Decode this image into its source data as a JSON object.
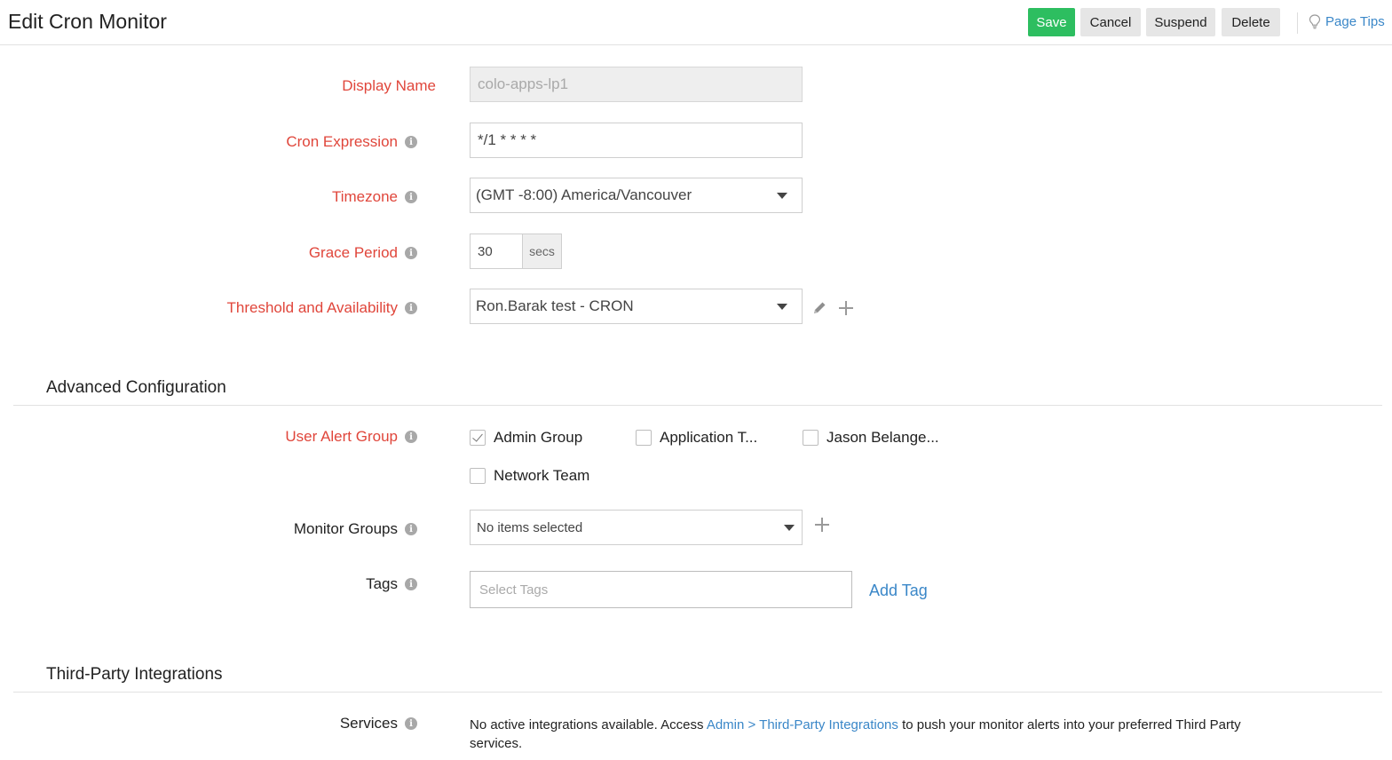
{
  "header": {
    "title": "Edit Cron Monitor",
    "buttons": {
      "save": "Save",
      "cancel": "Cancel",
      "suspend": "Suspend",
      "delete": "Delete"
    },
    "page_tips": "Page Tips"
  },
  "form": {
    "display_name": {
      "label": "Display Name",
      "value": "colo-apps-lp1"
    },
    "cron_expression": {
      "label": "Cron Expression",
      "value": "*/1 * * * *"
    },
    "timezone": {
      "label": "Timezone",
      "value": "(GMT -8:00) America/Vancouver"
    },
    "grace_period": {
      "label": "Grace Period",
      "value": "30",
      "unit": "secs"
    },
    "threshold": {
      "label": "Threshold and Availability",
      "value": "Ron.Barak test - CRON"
    }
  },
  "advanced": {
    "title": "Advanced Configuration",
    "user_alert_group": {
      "label": "User Alert Group",
      "options": [
        {
          "label": "Admin Group",
          "checked": true
        },
        {
          "label": "Application T...",
          "checked": false
        },
        {
          "label": "Jason Belange...",
          "checked": false
        },
        {
          "label": "Network Team",
          "checked": false
        }
      ]
    },
    "monitor_groups": {
      "label": "Monitor Groups",
      "value": "No items selected"
    },
    "tags": {
      "label": "Tags",
      "placeholder": "Select Tags",
      "add_label": "Add Tag"
    }
  },
  "integrations": {
    "title": "Third-Party Integrations",
    "services_label": "Services",
    "text_before": "No active integrations available. Access ",
    "link": "Admin > Third-Party Integrations",
    "text_after": " to push your monitor alerts into your preferred Third Party services."
  },
  "colors": {
    "required_label": "#e0463b",
    "link": "#3a87c8",
    "save_button": "#2dbe60"
  }
}
